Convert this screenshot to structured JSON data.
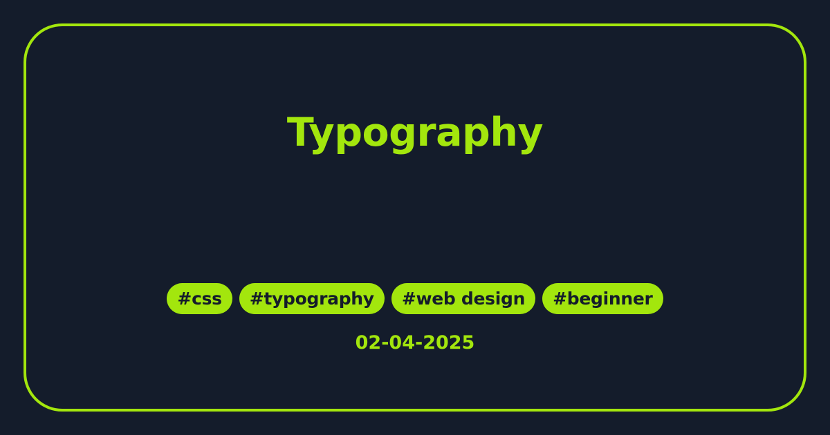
{
  "title": "Typography",
  "tags": [
    "#css",
    "#typography",
    "#web design",
    "#beginner"
  ],
  "date": "02-04-2025",
  "colors": {
    "background": "#141c2b",
    "accent": "#a3e60d"
  }
}
